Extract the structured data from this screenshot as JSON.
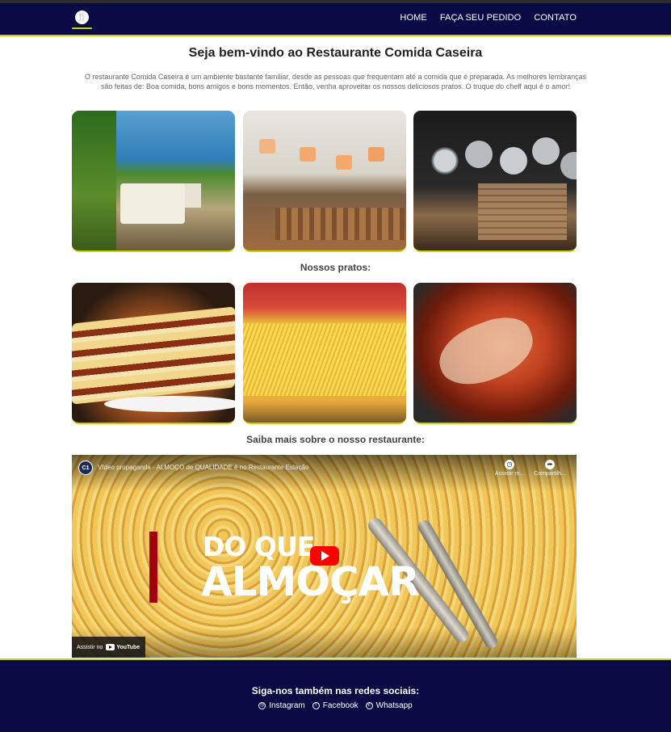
{
  "nav": {
    "logo_glyph": "🍴",
    "links": [
      "HOME",
      "FAÇA SEU PEDIDO",
      "CONTATO"
    ]
  },
  "main": {
    "title": "Seja bem-vindo ao Restaurante Comida Caseira",
    "intro": "O restaurante Comida Caseira é um ambiente bastante familiar, desde as pessoas que frequentam até a comida que é preparada. As melhores lembranças são feitas de: Boa comida, bons amigos e bons momentos. Então, venha aproveitar os nossos deliciosos pratos. O truque do cheff aqui é o amor!",
    "dishes_heading": "Nossos pratos:",
    "video_heading": "Saiba mais sobre o nosso restaurante:"
  },
  "video": {
    "channel_badge": "C1",
    "title": "Vídeo propaganda - ALMOÇO de QUALIDADE é no Restaurante Estação",
    "overlay_line1": "DO QUE",
    "overlay_line2": "ALMOÇAR",
    "watch_later": "Assistir m...",
    "share": "Compartilh...",
    "watch_on": "Assistir no",
    "youtube": "YouTube"
  },
  "footer": {
    "title": "Siga-nos também nas redes sociais:",
    "links": [
      "Instagram",
      "Facebook",
      "Whatsapp"
    ]
  },
  "colors": {
    "navy": "#0a0a45",
    "accent": "#c9d200",
    "youtube_red": "#ff0000"
  }
}
